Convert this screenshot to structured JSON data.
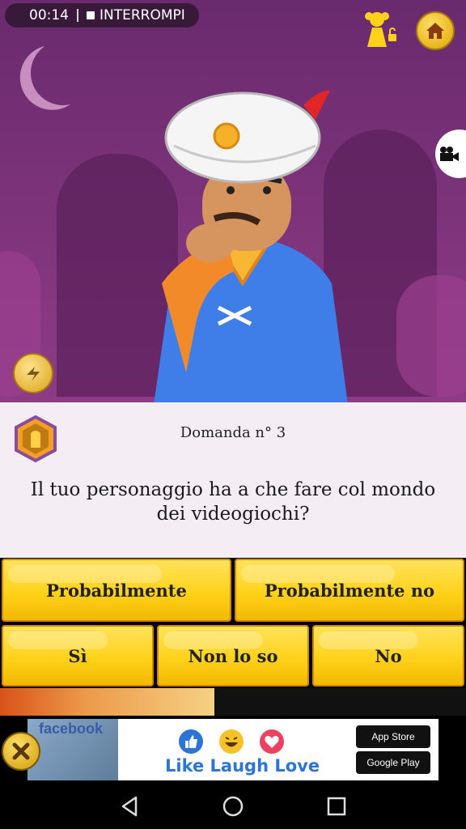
{
  "recording": {
    "time": "00:14",
    "stop_label": "INTERROMPI"
  },
  "question": {
    "number_label": "Domanda n° 3",
    "text": "Il tuo personaggio ha a che fare col mondo dei videogiochi?"
  },
  "answers": {
    "probably": "Probabilmente",
    "probably_not": "Probabilmente no",
    "yes": "Sì",
    "dont_know": "Non lo so",
    "no": "No"
  },
  "progress": {
    "fraction": 0.46
  },
  "ad": {
    "brand": "facebook",
    "slogan": "Like Laugh Love",
    "app_store": "App Store",
    "google_play": "Google Play"
  },
  "icons": {
    "home": "home-icon",
    "kid": "kid-mode-icon",
    "video": "video-camera-icon",
    "back": "undo-icon",
    "close": "close-icon"
  },
  "colors": {
    "button": "#ffd21a",
    "panel": "#f4eef4",
    "scene": "#7a3278"
  }
}
